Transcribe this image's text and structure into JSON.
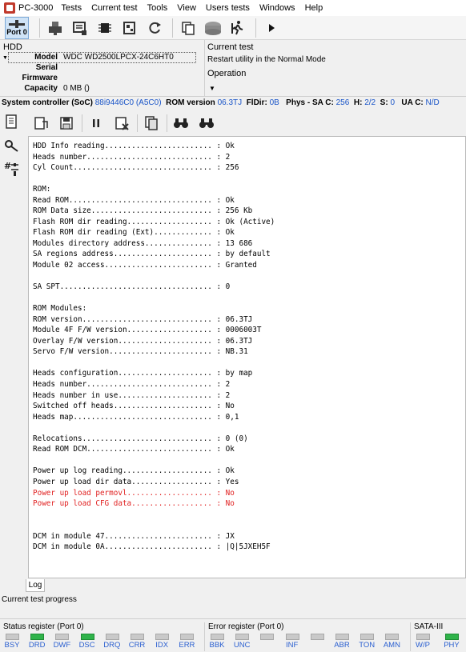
{
  "app": {
    "title": "PC-3000",
    "menu": [
      "Tests",
      "Current test",
      "Tools",
      "View",
      "Users tests",
      "Windows",
      "Help"
    ]
  },
  "toolbar": {
    "port_label": "Port 0"
  },
  "hdd": {
    "caption": "HDD",
    "model_label": "Model",
    "model_value": "WDC WD2500LPCX-24C6HT0",
    "serial_label": "Serial",
    "serial_value": "",
    "firmware_label": "Firmware",
    "firmware_value": "",
    "capacity_label": "Capacity",
    "capacity_value": "0 MB ()"
  },
  "current_test": {
    "caption": "Current test",
    "value": "Restart utility in the Normal Mode",
    "operation_caption": "Operation"
  },
  "system_line": {
    "soc_label": "System controller (SoC)",
    "soc_value": "88i9446C0 (A5C0)",
    "rom_label": "ROM version",
    "rom_value": "06.3TJ",
    "fldir_label": "FlDir:",
    "fldir_value": "0B",
    "phys_label": "Phys - SA C:",
    "phys_value": "256",
    "h_label": "H:",
    "h_value": "2/2",
    "s_label": "S:",
    "s_value": "0",
    "uac_label": "UA C:",
    "uac_value": "N/D"
  },
  "log": {
    "lines": [
      {
        "text": "HDD Info reading........................ : Ok",
        "red": false
      },
      {
        "text": "Heads number............................ : 2",
        "red": false
      },
      {
        "text": "Cyl Count............................... : 256",
        "red": false
      },
      {
        "text": "",
        "red": false
      },
      {
        "text": "ROM:",
        "red": false
      },
      {
        "text": "Read ROM................................ : Ok",
        "red": false
      },
      {
        "text": "ROM Data size........................... : 256 Kb",
        "red": false
      },
      {
        "text": "Flash ROM dir reading................... : Ok (Active)",
        "red": false
      },
      {
        "text": "Flash ROM dir reading (Ext)............. : Ok",
        "red": false
      },
      {
        "text": "Modules directory address............... : 13 686",
        "red": false
      },
      {
        "text": "SA regions address...................... : by default",
        "red": false
      },
      {
        "text": "Module 02 access........................ : Granted",
        "red": false
      },
      {
        "text": "",
        "red": false
      },
      {
        "text": "SA SPT.................................. : 0",
        "red": false
      },
      {
        "text": "",
        "red": false
      },
      {
        "text": "ROM Modules:",
        "red": false
      },
      {
        "text": "ROM version............................. : 06.3TJ",
        "red": false
      },
      {
        "text": "Module 4F F/W version................... : 0006003T",
        "red": false
      },
      {
        "text": "Overlay F/W version..................... : 06.3TJ",
        "red": false
      },
      {
        "text": "Servo F/W version....................... : NB.31",
        "red": false
      },
      {
        "text": "",
        "red": false
      },
      {
        "text": "Heads configuration..................... : by map",
        "red": false
      },
      {
        "text": "Heads number............................ : 2",
        "red": false
      },
      {
        "text": "Heads number in use..................... : 2",
        "red": false
      },
      {
        "text": "Switched off heads...................... : No",
        "red": false
      },
      {
        "text": "Heads map............................... : 0,1",
        "red": false
      },
      {
        "text": "",
        "red": false
      },
      {
        "text": "Relocations............................. : 0 (0)",
        "red": false
      },
      {
        "text": "Read ROM DCM............................ : Ok",
        "red": false
      },
      {
        "text": "",
        "red": false
      },
      {
        "text": "Power up log reading.................... : Ok",
        "red": false
      },
      {
        "text": "Power up load dir data.................. : Yes",
        "red": false
      },
      {
        "text": "Power up load permovl................... : No",
        "red": true
      },
      {
        "text": "Power up load CFG data.................. : No",
        "red": true
      },
      {
        "text": "",
        "red": false
      },
      {
        "text": "",
        "red": false
      },
      {
        "text": "DCM in module 47........................ : JX",
        "red": false
      },
      {
        "text": "DCM in module 0A........................ : |Q|5JXEH5F",
        "red": false
      }
    ],
    "tab_label": "Log"
  },
  "progress": {
    "caption": "Current test progress"
  },
  "status_register": {
    "caption": "Status register (Port 0)",
    "leds": [
      {
        "label": "BSY",
        "on": false
      },
      {
        "label": "DRD",
        "on": true
      },
      {
        "label": "DWF",
        "on": false
      },
      {
        "label": "DSC",
        "on": true
      },
      {
        "label": "DRQ",
        "on": false
      },
      {
        "label": "CRR",
        "on": false
      },
      {
        "label": "IDX",
        "on": false
      },
      {
        "label": "ERR",
        "on": false
      }
    ]
  },
  "error_register": {
    "caption": "Error register (Port 0)",
    "leds": [
      {
        "label": "BBK",
        "on": false
      },
      {
        "label": "UNC",
        "on": false
      },
      {
        "label": "",
        "on": false
      },
      {
        "label": "INF",
        "on": false
      },
      {
        "label": "",
        "on": false
      },
      {
        "label": "ABR",
        "on": false
      },
      {
        "label": "TON",
        "on": false
      },
      {
        "label": "AMN",
        "on": false
      }
    ]
  },
  "sata": {
    "caption": "SATA-III",
    "leds": [
      {
        "label": "W/P",
        "on": false
      },
      {
        "label": "PHY",
        "on": true
      }
    ]
  },
  "colors": {
    "accent_blue": "#1a55c8",
    "led_on": "#2fb34a",
    "log_error": "#e02020"
  }
}
